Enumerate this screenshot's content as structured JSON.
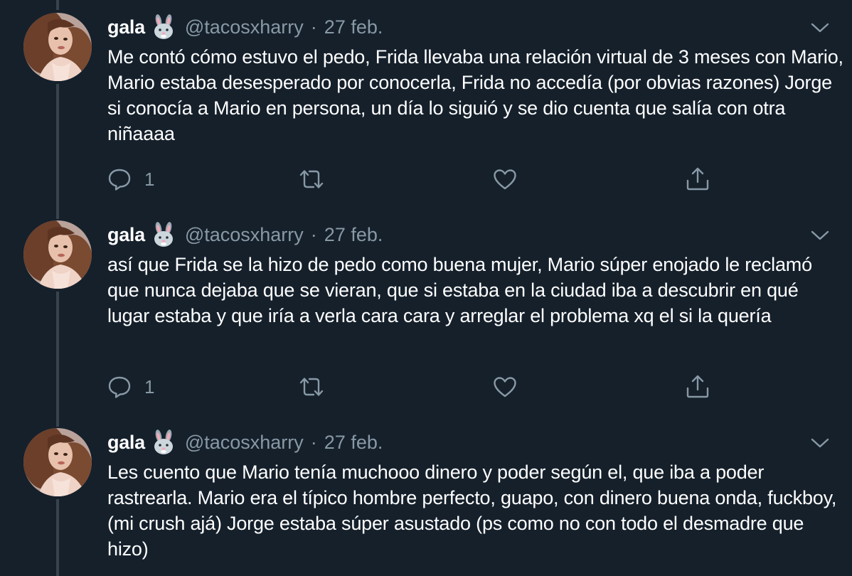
{
  "colors": {
    "background": "#15202b",
    "text": "#ffffff",
    "muted": "#8899a6",
    "thread_line": "#38444d"
  },
  "tweets": [
    {
      "name": "gala",
      "emoji": "rabbit-face",
      "handle": "@tacosxharry",
      "separator": "·",
      "date": "27 feb.",
      "text": "Me contó cómo estuvo el pedo, Frida llevaba una relación virtual de 3 meses con Mario, Mario estaba desesperado por conocerla, Frida no accedía (por obvias razones) Jorge si conocía a Mario en persona, un día lo siguió y se dio cuenta que salía con otra niñaaaa",
      "reply_count": "1",
      "icons": [
        "reply-icon",
        "retweet-icon",
        "like-icon",
        "share-icon"
      ]
    },
    {
      "name": "gala",
      "emoji": "rabbit-face",
      "handle": "@tacosxharry",
      "separator": "·",
      "date": "27 feb.",
      "text": "así que Frida se la hizo de pedo como buena mujer, Mario súper enojado le reclamó que nunca dejaba que se vieran, que si estaba en la ciudad iba a descubrir en qué lugar estaba y que iría a verla cara cara y arreglar el problema xq el si la quería",
      "reply_count": "1",
      "icons": [
        "reply-icon",
        "retweet-icon",
        "like-icon",
        "share-icon"
      ]
    },
    {
      "name": "gala",
      "emoji": "rabbit-face",
      "handle": "@tacosxharry",
      "separator": "·",
      "date": "27 feb.",
      "text": "Les cuento que Mario tenía muchooo dinero y poder según el, que iba a poder rastrearla. Mario era el típico hombre perfecto, guapo, con dinero buena onda, fuckboy, (mi crush ajá) Jorge estaba súper asustado (ps como no con todo el desmadre que hizo)"
    }
  ]
}
